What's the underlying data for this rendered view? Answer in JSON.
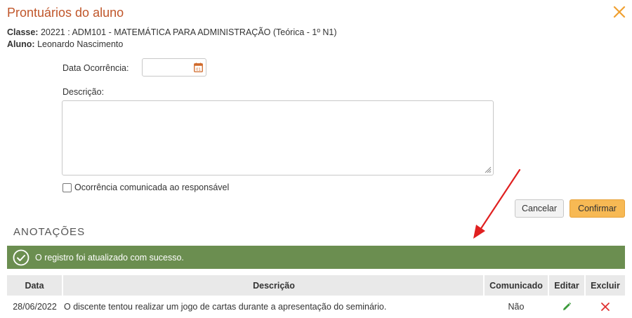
{
  "dialog": {
    "title": "Prontuários do aluno",
    "close_icon": "close-icon"
  },
  "info": {
    "classe_label": "Classe:",
    "classe_value": "20221 : ADM101 - MATEMÁTICA PARA ADMINISTRAÇÃO (Teórica - 1º N1)",
    "aluno_label": "Aluno:",
    "aluno_value": "Leonardo Nascimento"
  },
  "form": {
    "data_label": "Data Ocorrência:",
    "data_value": "",
    "descricao_label": "Descrição:",
    "descricao_value": "",
    "checkbox_label": "Ocorrência comunicada ao responsável",
    "checkbox_checked": false,
    "cancel_label": "Cancelar",
    "confirm_label": "Confirmar"
  },
  "anotacoes": {
    "title": "ANOTAÇÕES",
    "alert_text": "O registro foi atualizado com sucesso.",
    "columns": [
      "Data",
      "Descrição",
      "Comunicado",
      "Editar",
      "Excluir"
    ],
    "rows": [
      {
        "data": "28/06/2022",
        "descricao": "O discente tentou realizar um jogo de cartas durante a apresentação do seminário.",
        "comunicado": "Não"
      }
    ]
  },
  "colors": {
    "title": "#c0562a",
    "close": "#f0a030",
    "confirm_button": "#f7b954",
    "alert_bg": "#6b8e50",
    "edit_icon": "#3a9a3a",
    "delete_icon": "#e03030",
    "arrow": "#e02020"
  }
}
